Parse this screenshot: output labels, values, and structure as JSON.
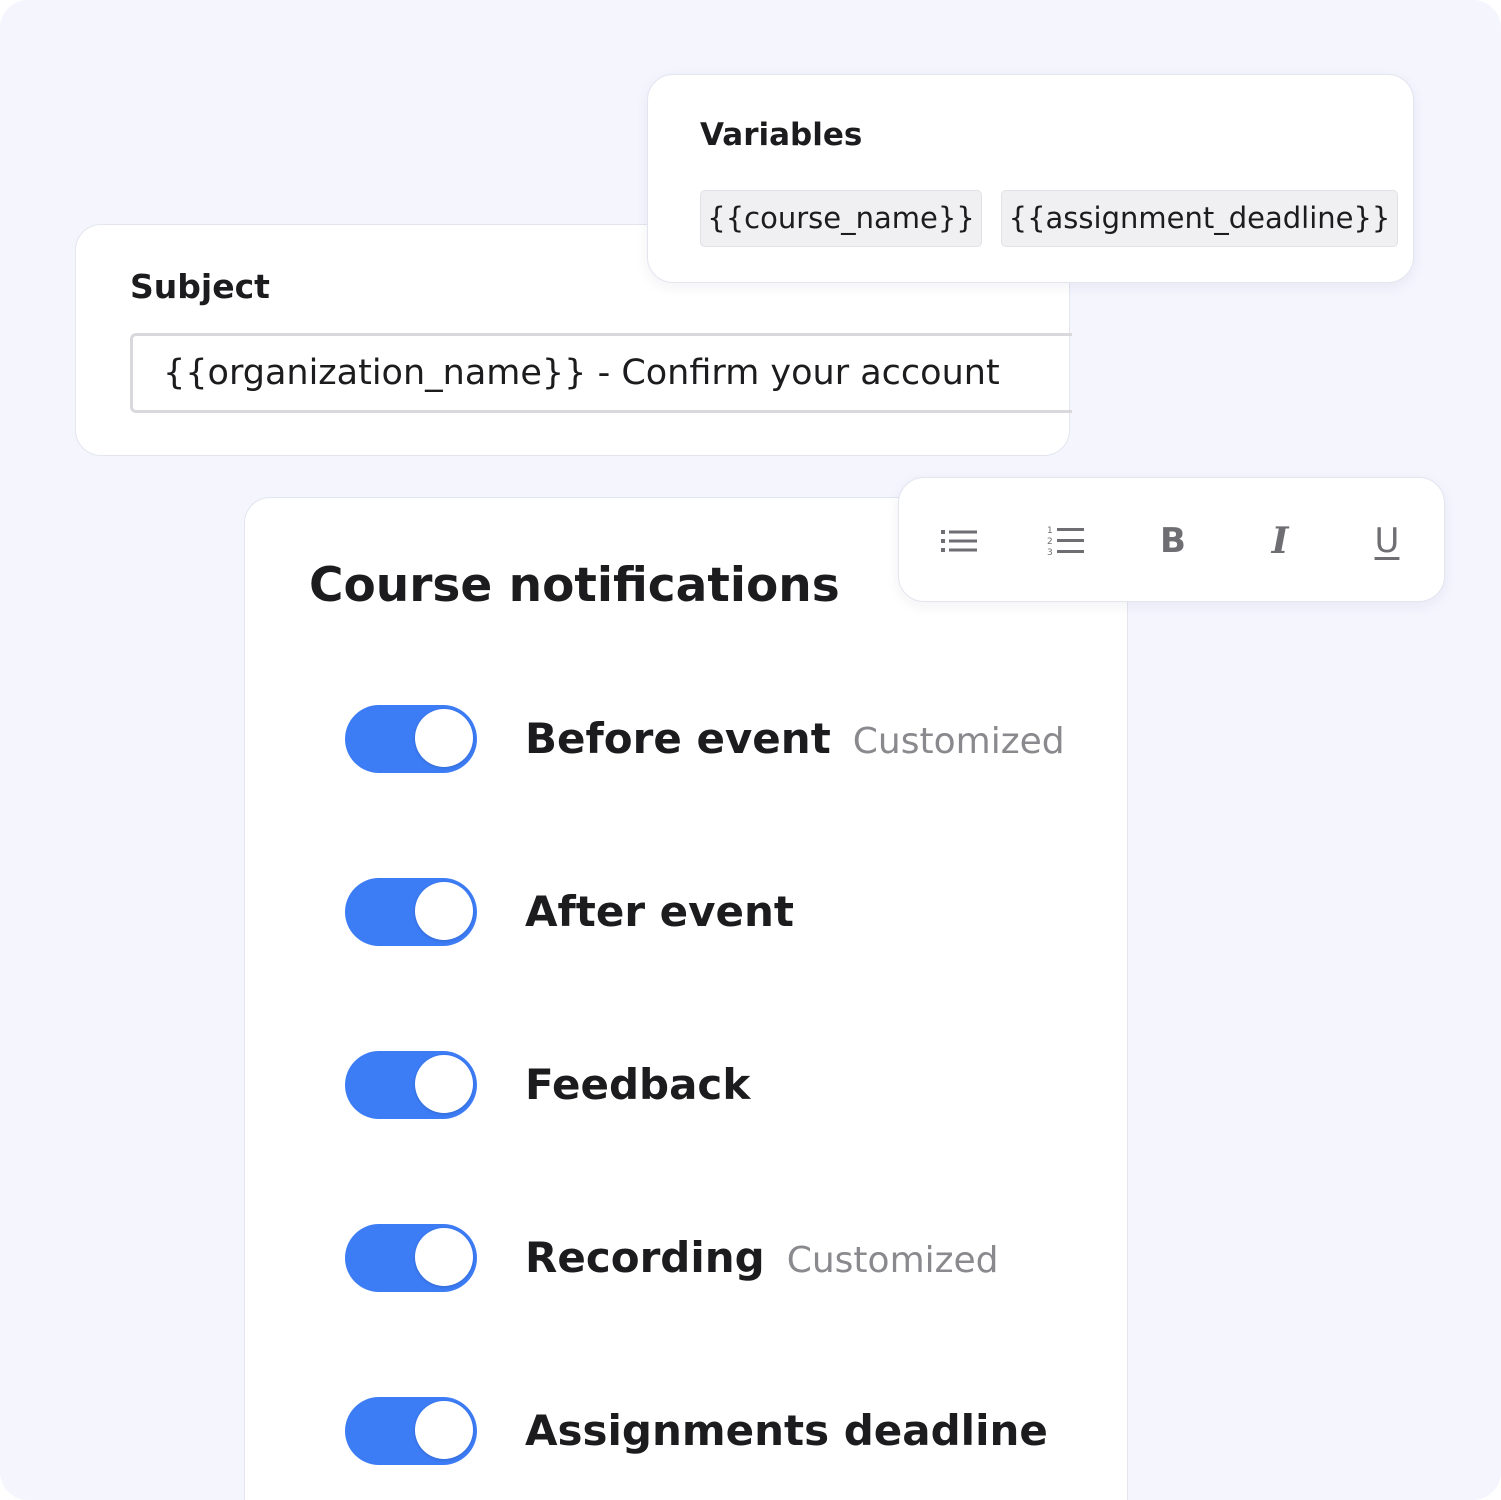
{
  "subject": {
    "label": "Subject",
    "value": "{{organization_name}} - Confirm your account"
  },
  "variables": {
    "label": "Variables",
    "chips": [
      "{{course_name}}",
      "{{assignment_deadline}}"
    ]
  },
  "toolbar": {
    "tools": [
      {
        "name": "bulleted-list",
        "icon": "bulleted-list-icon"
      },
      {
        "name": "numbered-list",
        "icon": "numbered-list-icon"
      },
      {
        "name": "bold",
        "glyph": "B"
      },
      {
        "name": "italic",
        "glyph": "I"
      },
      {
        "name": "underline",
        "glyph": "U"
      }
    ]
  },
  "notifications": {
    "title": "Course notifications",
    "items": [
      {
        "label": "Before event",
        "badge": "Customized",
        "enabled": true
      },
      {
        "label": "After event",
        "badge": "",
        "enabled": true
      },
      {
        "label": "Feedback",
        "badge": "",
        "enabled": true
      },
      {
        "label": "Recording",
        "badge": "Customized",
        "enabled": true
      },
      {
        "label": "Assignments deadline",
        "badge": "",
        "enabled": true
      }
    ]
  },
  "colors": {
    "background": "#f4f5fd",
    "toggle_on": "#3c7cf5",
    "badge_text": "#8a8a8e",
    "icon_gray": "#6f6f73"
  }
}
